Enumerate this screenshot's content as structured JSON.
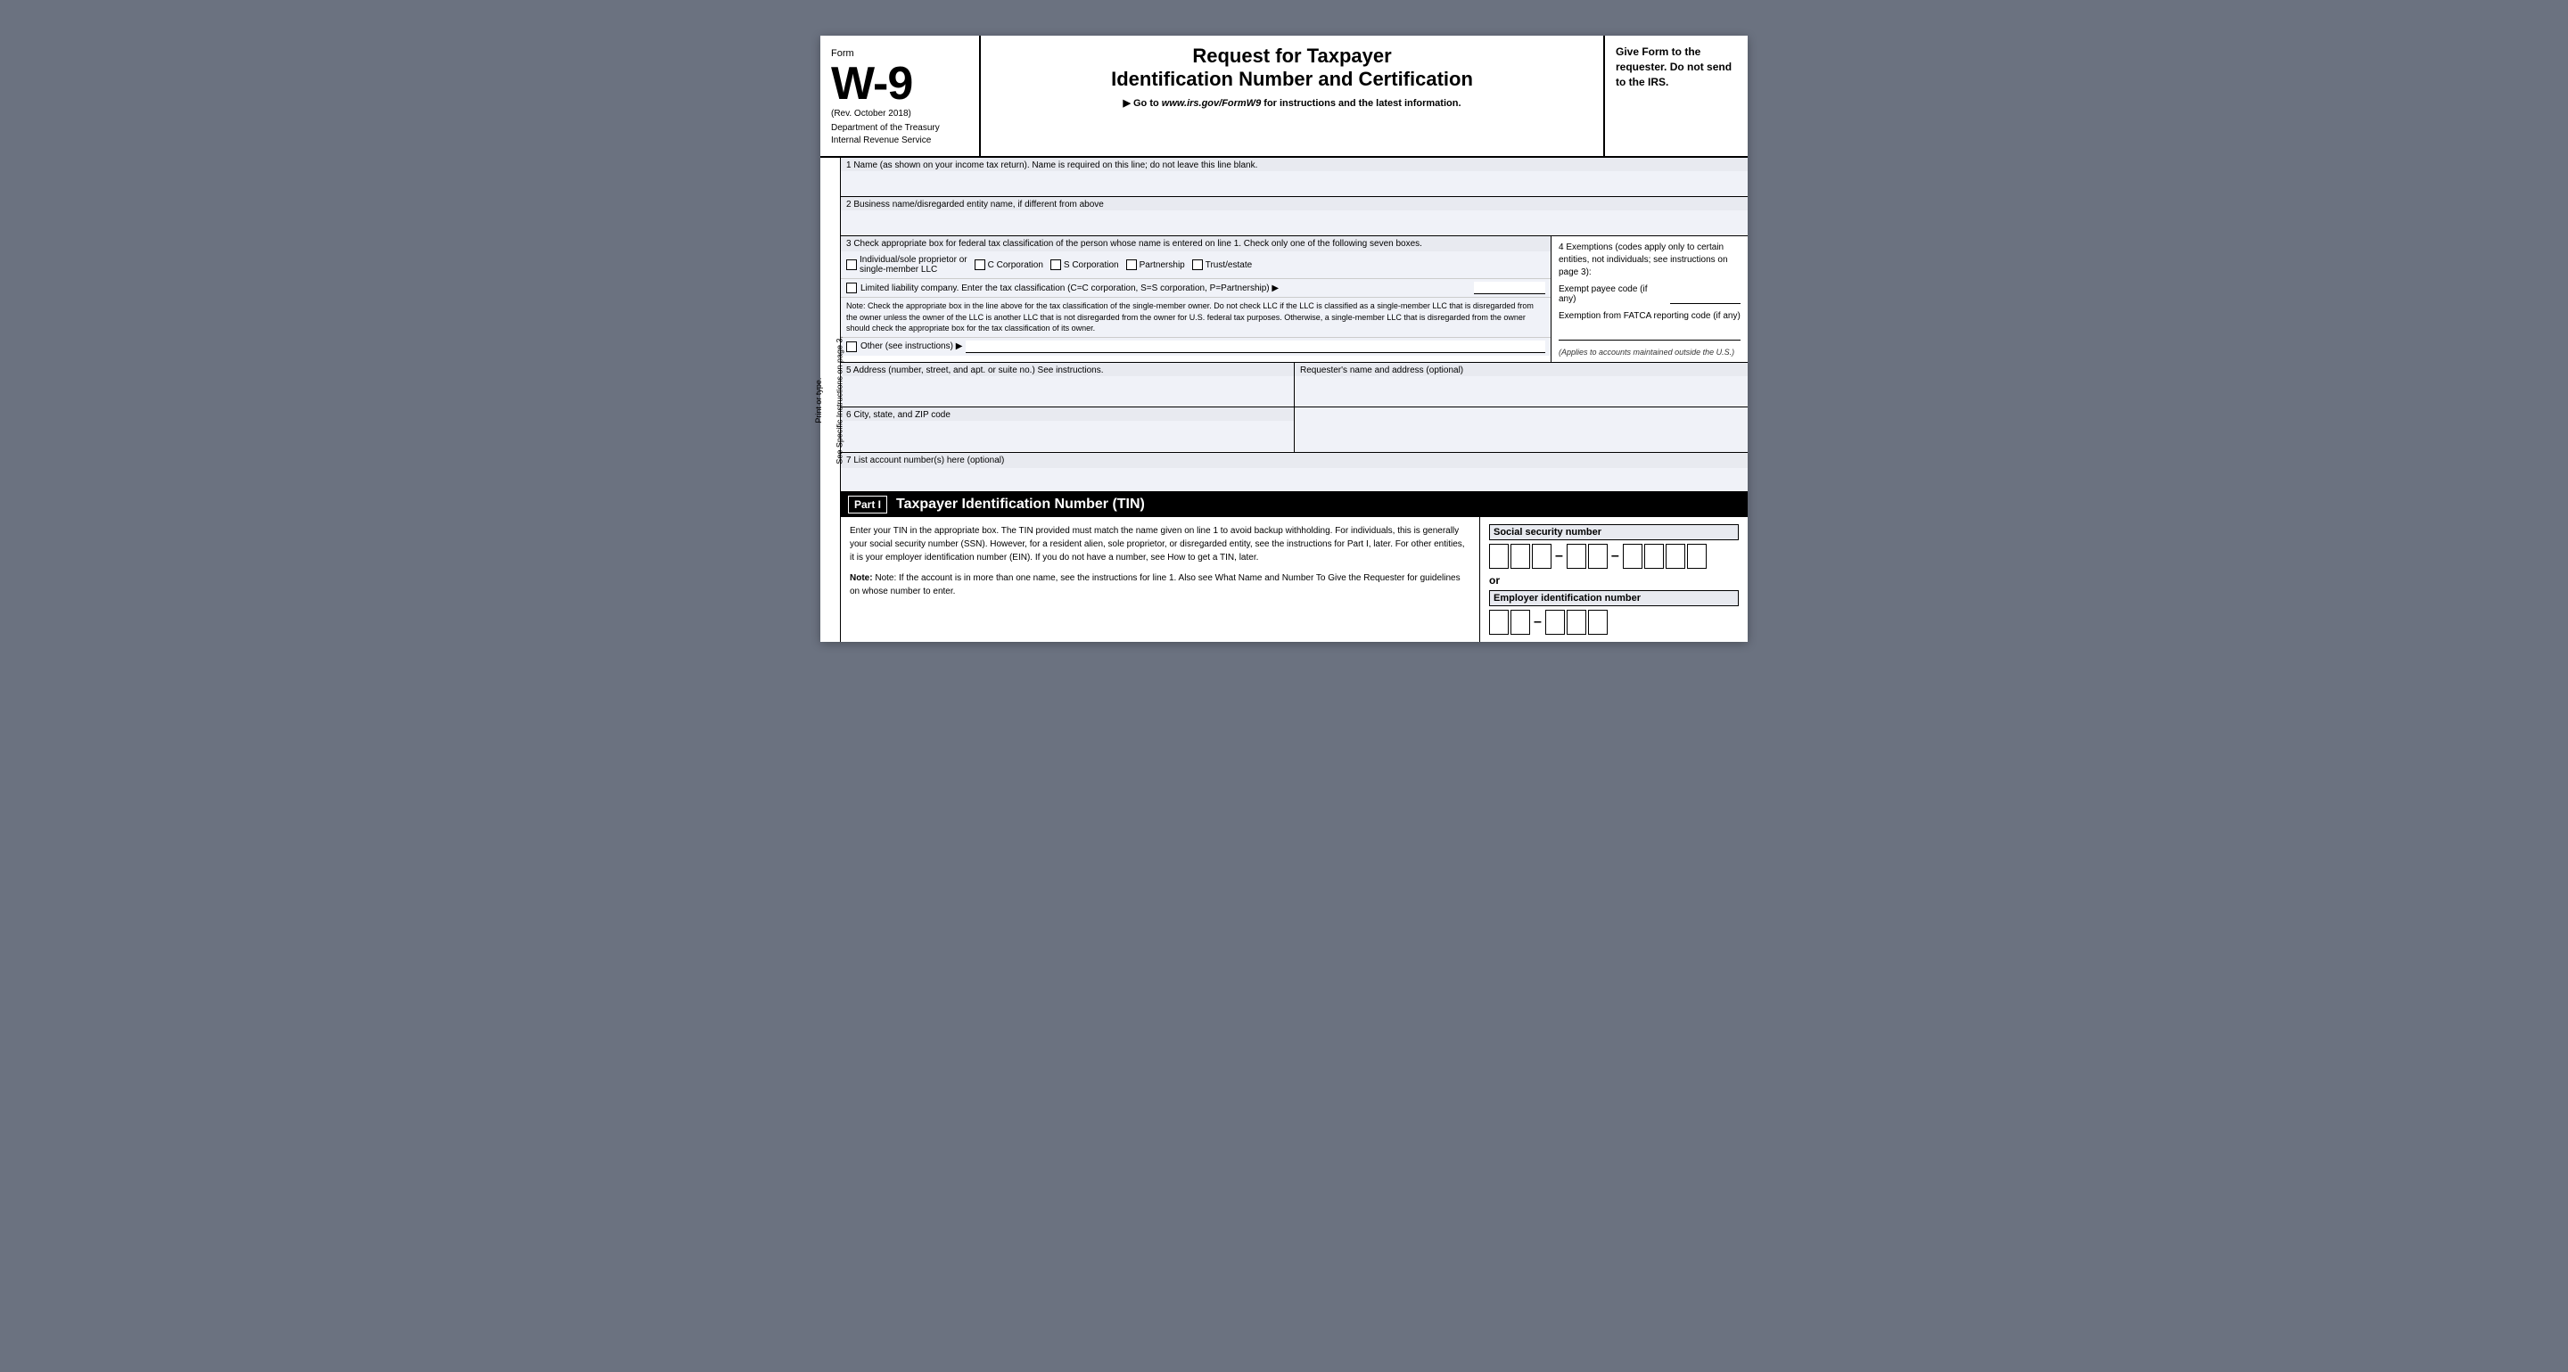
{
  "header": {
    "form_label": "Form",
    "form_number": "W-9",
    "rev": "(Rev. October 2018)",
    "dept": "Department of the Treasury\nInternal Revenue Service",
    "title": "Request for Taxpayer\nIdentification Number and Certification",
    "go_to": "▶ Go to",
    "url": "www.irs.gov/FormW9",
    "url_suffix": " for instructions and the latest information.",
    "give_form": "Give Form to the requester. Do not send to the IRS."
  },
  "fields": {
    "field1_label": "1  Name (as shown on your income tax return). Name is required on this line; do not leave this line blank.",
    "field2_label": "2  Business name/disregarded entity name, if different from above",
    "field3_header": "3  Check appropriate box for federal tax classification of the person whose name is entered on line 1. Check only one of the following seven boxes.",
    "checkbox_individual": "Individual/sole proprietor or\nsingle-member LLC",
    "checkbox_c_corp": "C Corporation",
    "checkbox_s_corp": "S Corporation",
    "checkbox_partnership": "Partnership",
    "checkbox_trust": "Trust/estate",
    "llc_text": "Limited liability company. Enter the tax classification (C=C corporation, S=S corporation, P=Partnership) ▶",
    "note_text": "Note: Check the appropriate box in the line above for the tax classification of the single-member owner.  Do not check LLC if the LLC is classified as a single-member LLC that is disregarded from the owner unless the owner of the LLC is another LLC that is not disregarded from the owner for U.S. federal tax purposes. Otherwise, a single-member LLC that is disregarded from the owner should check the appropriate box for the tax classification of its owner.",
    "other_text": "Other (see instructions) ▶",
    "exemptions_label": "4  Exemptions (codes apply only to certain entities, not individuals; see instructions on page 3):",
    "exempt_payee_label": "Exempt payee code (if any)",
    "fatca_label": "Exemption from FATCA reporting code (if any)",
    "fatca_note": "(Applies to accounts maintained outside the U.S.)",
    "field5_label": "5  Address (number, street, and apt. or suite no.) See instructions.",
    "requester_label": "Requester's name and address (optional)",
    "field6_label": "6  City, state, and ZIP code",
    "field7_label": "7  List account number(s) here (optional)",
    "part1_label": "Part I",
    "part1_title": "Taxpayer Identification Number (TIN)",
    "part1_text": "Enter your TIN in the appropriate box. The TIN provided must match the name given on line 1 to avoid backup withholding. For individuals, this is generally your social security number (SSN). However, for a resident alien, sole proprietor, or disregarded entity, see the instructions for Part I, later. For other entities, it is your employer identification number (EIN). If you do not have a number, see How to get a TIN, later.",
    "part1_note": "Note: If the account is in more than one name, see the instructions for line 1. Also see What Name and Number To Give the Requester for guidelines on whose number to enter.",
    "ssn_label": "Social security number",
    "or_text": "or",
    "ein_label": "Employer identification number",
    "side_top": "Print or type.",
    "side_bottom": "See Specific Instructions on page 3."
  }
}
